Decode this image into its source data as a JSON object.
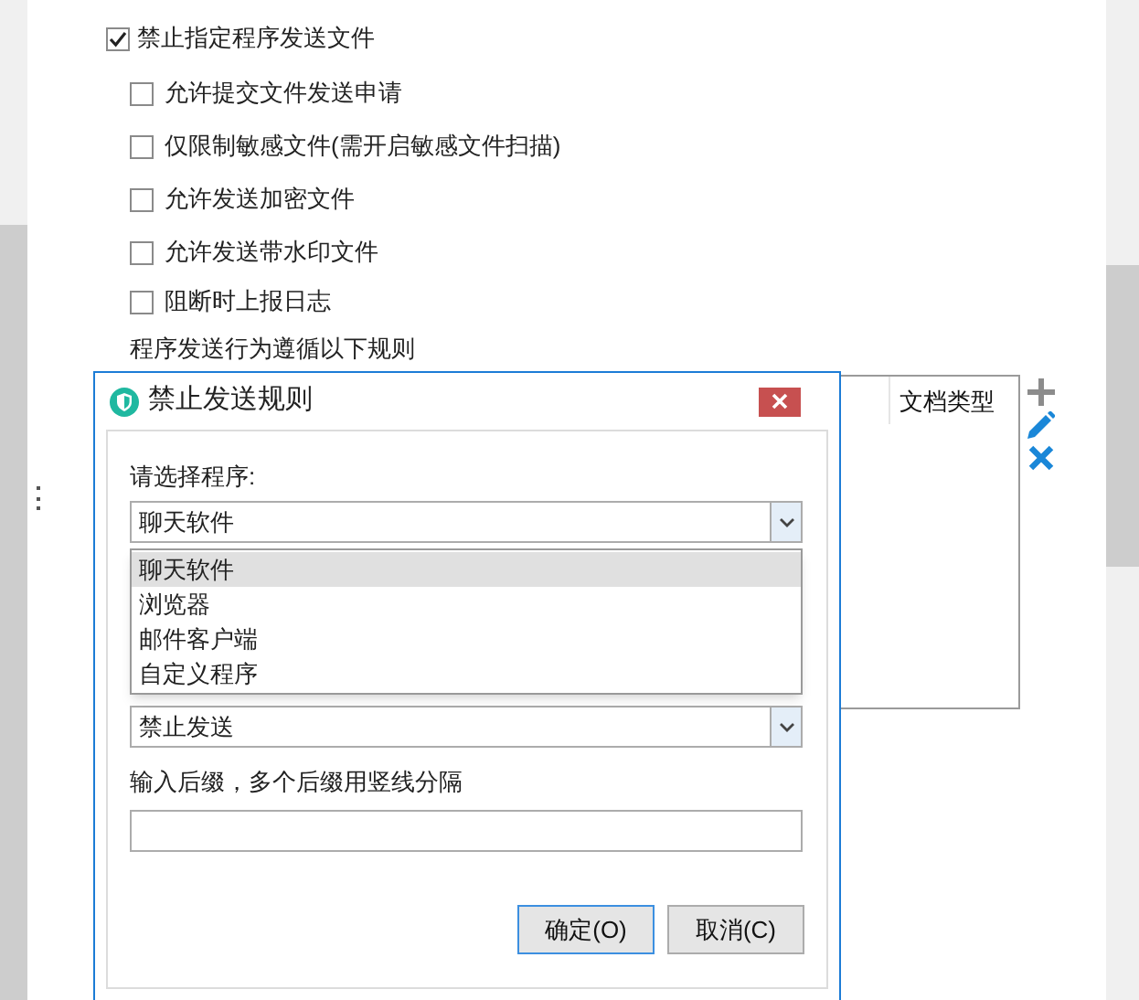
{
  "options": {
    "main": {
      "label": "禁止指定程序发送文件",
      "checked": true
    },
    "sub": [
      {
        "label": "允许提交文件发送申请",
        "checked": false
      },
      {
        "label": "仅限制敏感文件(需开启敏感文件扫描)",
        "checked": false
      },
      {
        "label": "允许发送加密文件",
        "checked": false
      },
      {
        "label": "允许发送带水印文件",
        "checked": false
      },
      {
        "label": "阻断时上报日志",
        "checked": false
      }
    ]
  },
  "rules_label": "程序发送行为遵循以下规则",
  "rules_table": {
    "columns": [
      "文档类型"
    ]
  },
  "dialog": {
    "title": "禁止发送规则",
    "program_label": "请选择程序:",
    "program_select": {
      "value": "聊天软件",
      "expanded": true,
      "options": [
        {
          "label": "聊天软件",
          "selected": true
        },
        {
          "label": "浏览器",
          "selected": false
        },
        {
          "label": "邮件客户端",
          "selected": false
        },
        {
          "label": "自定义程序",
          "selected": false
        }
      ]
    },
    "action_select": {
      "value": "禁止发送"
    },
    "suffix_label": "输入后缀，多个后缀用竖线分隔",
    "buttons": [
      {
        "label": "确定(O)",
        "kind": "default"
      },
      {
        "label": "取消(C)",
        "kind": "normal"
      }
    ]
  }
}
